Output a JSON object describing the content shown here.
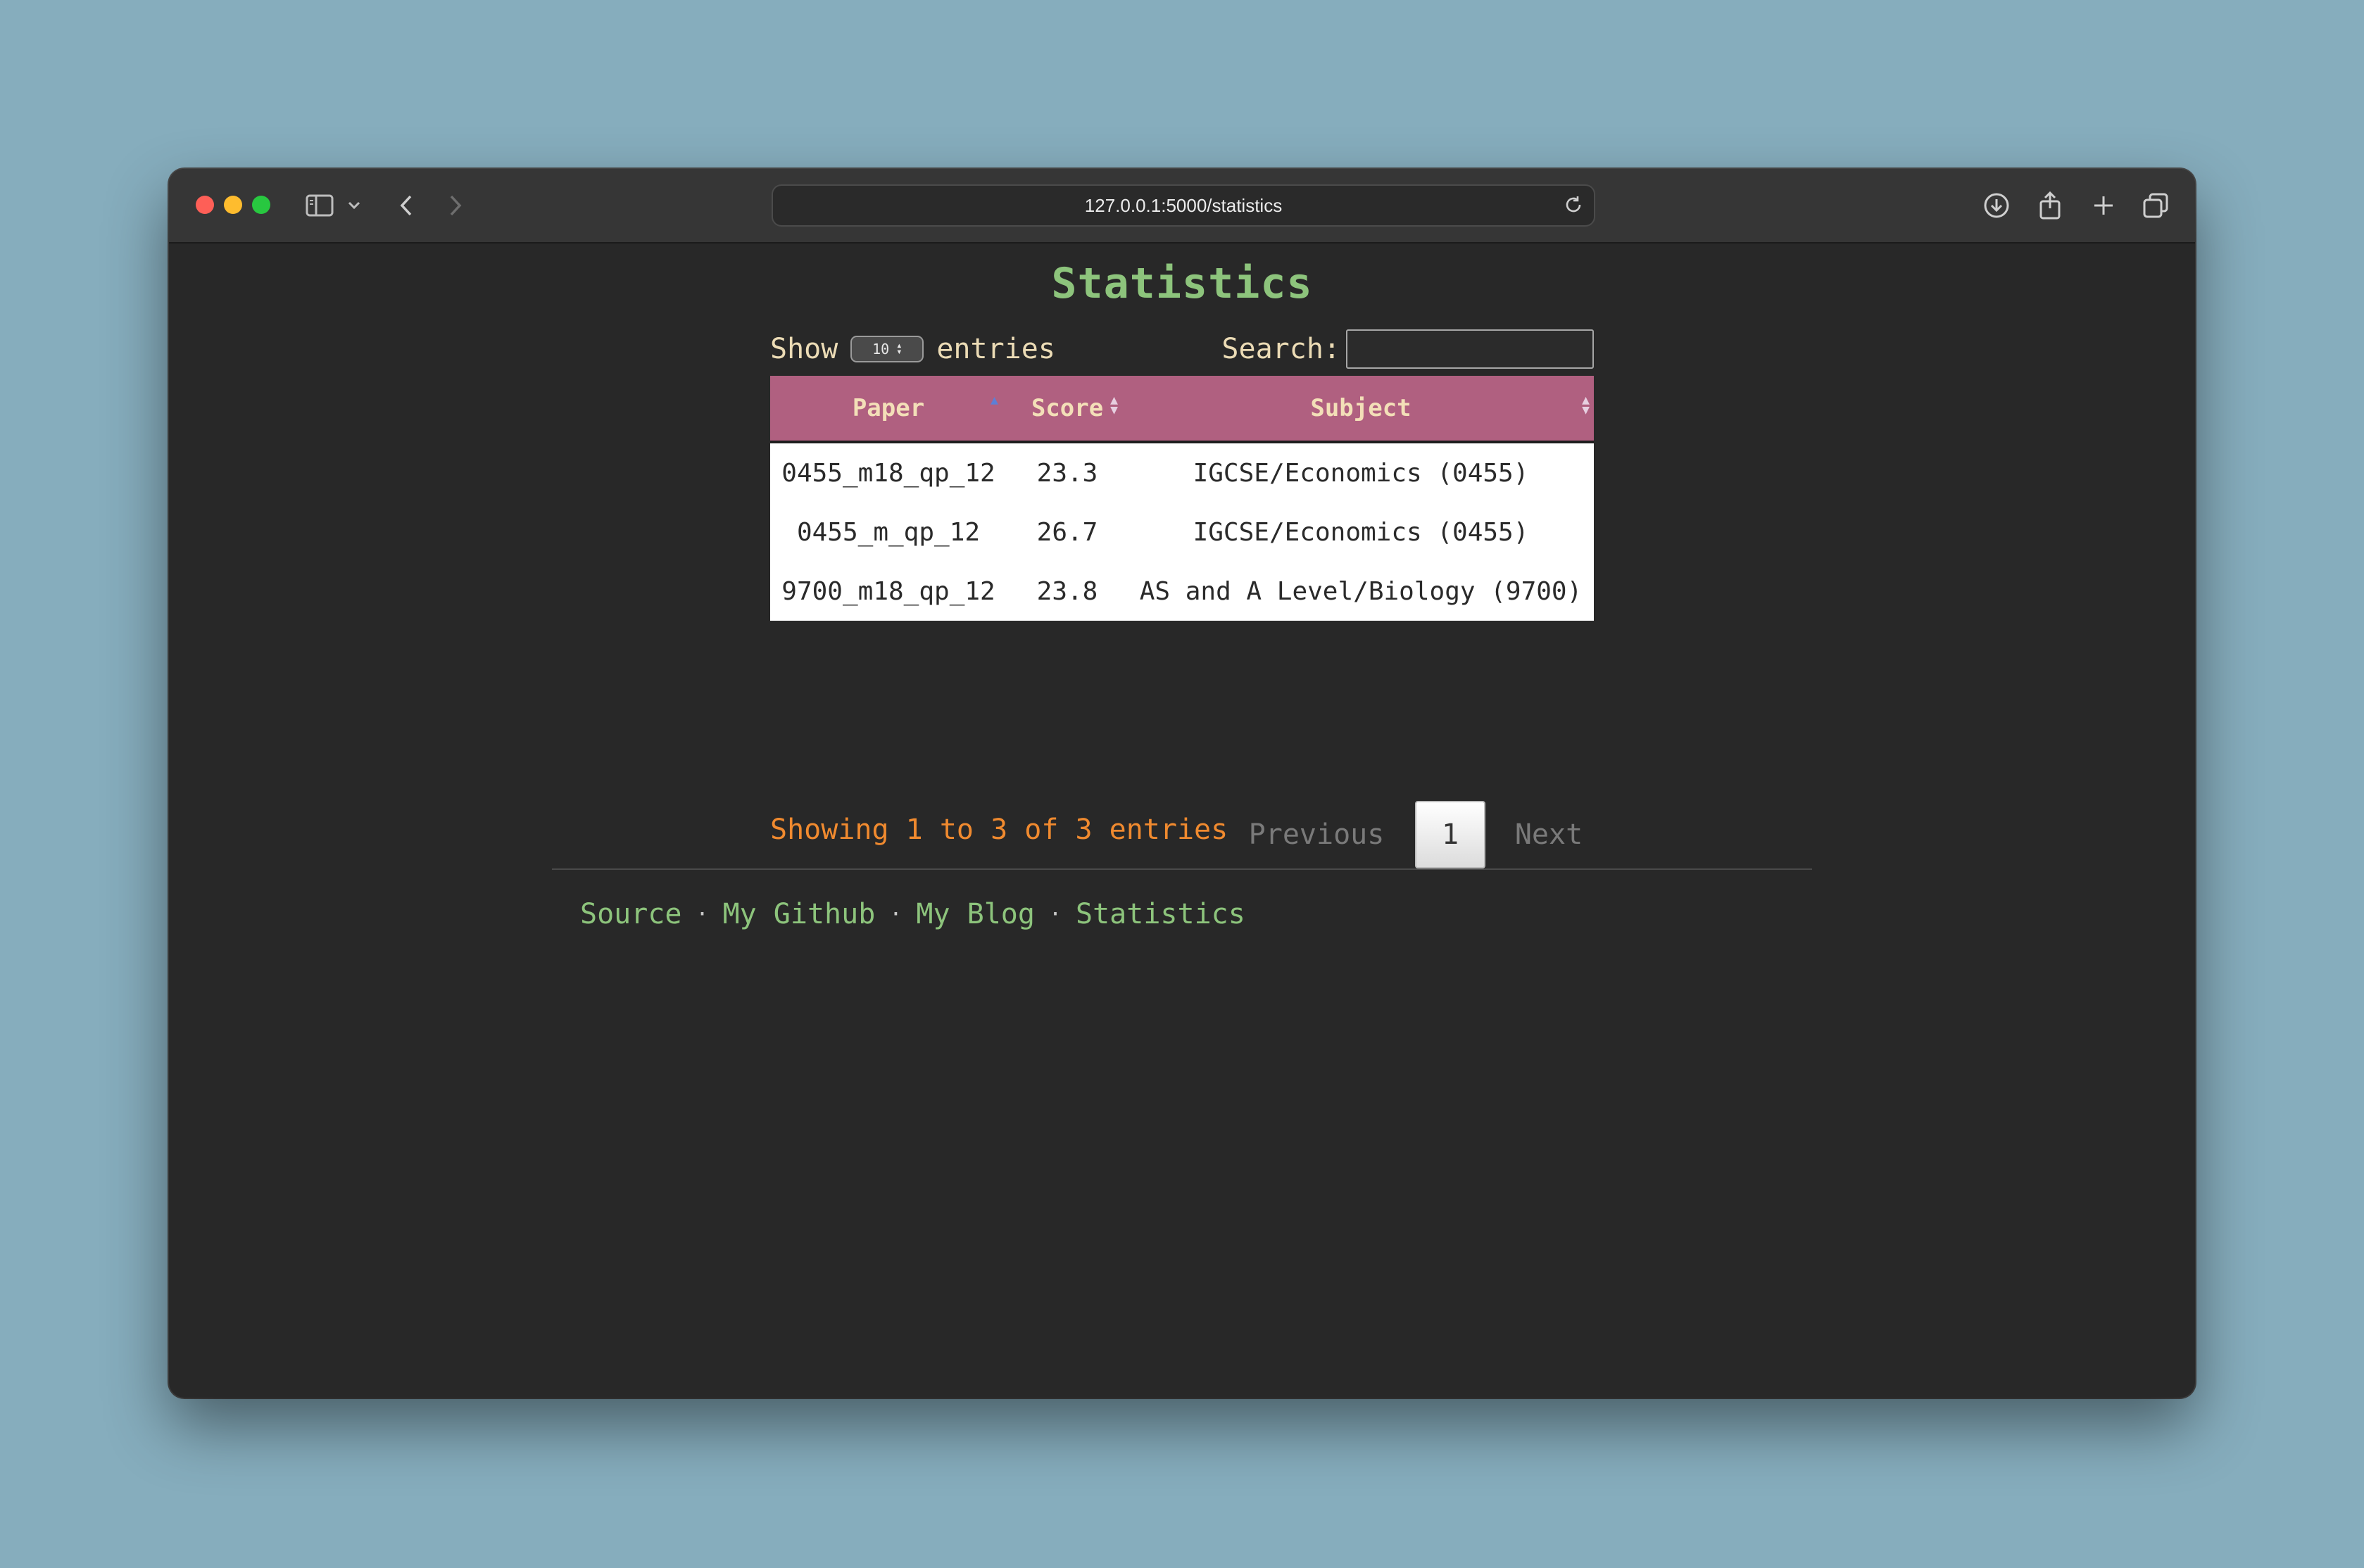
{
  "browser": {
    "url": "127.0.0.1:5000/statistics"
  },
  "page": {
    "title": "Statistics",
    "show_label": "Show",
    "entries_label": "entries",
    "page_length": "10",
    "search_label": "Search:",
    "search_value": ""
  },
  "table": {
    "columns": [
      "Paper",
      "Score",
      "Subject"
    ],
    "rows": [
      {
        "paper": "0455_m18_qp_12",
        "score": "23.3",
        "subject": "IGCSE/Economics (0455)"
      },
      {
        "paper": "0455_m_qp_12",
        "score": "26.7",
        "subject": "IGCSE/Economics (0455)"
      },
      {
        "paper": "9700_m18_qp_12",
        "score": "23.8",
        "subject": "AS and A Level/Biology (9700)"
      }
    ]
  },
  "pagination": {
    "info": "Showing 1 to 3 of 3 entries",
    "previous": "Previous",
    "current_page": "1",
    "next": "Next"
  },
  "footer": {
    "links": [
      "Source",
      "My Github",
      "My Blog",
      "Statistics"
    ],
    "separator": "·"
  },
  "colors": {
    "accent_green": "#8dc47c",
    "header_pink": "#b06080",
    "info_orange": "#f08a2f",
    "page_bg": "#282828"
  }
}
